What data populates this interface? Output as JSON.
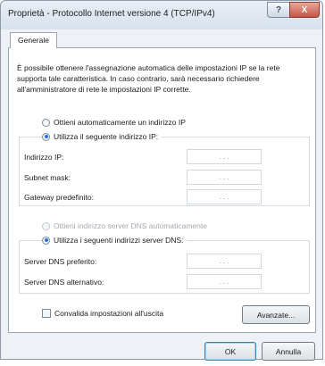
{
  "window": {
    "title": "Proprietà - Protocollo Internet versione 4 (TCP/IPv4)",
    "help_glyph": "?",
    "close_glyph": "X"
  },
  "tabs": [
    {
      "label": "Generale"
    }
  ],
  "description": "È possibile ottenere l'assegnazione automatica delle impostazioni IP se la rete supporta tale caratteristica. In caso contrario, sarà necessario richiedere all'amministratore di rete le impostazioni IP corrette.",
  "ip_section": {
    "auto_option": {
      "label": "Ottieni automaticamente un indirizzo IP",
      "selected": false
    },
    "manual_option": {
      "label": "Utilizza il seguente indirizzo IP:",
      "selected": true
    },
    "fields": [
      {
        "label": "Indirizzo IP:",
        "value": ". . ."
      },
      {
        "label": "Subnet mask:",
        "value": ". . ."
      },
      {
        "label": "Gateway predefinito:",
        "value": ". . ."
      }
    ]
  },
  "dns_section": {
    "auto_option": {
      "label": "Ottieni indirizzo server DNS automaticamente",
      "selected": false,
      "disabled": true
    },
    "manual_option": {
      "label": "Utilizza i seguenti indirizzi server DNS:",
      "selected": true
    },
    "fields": [
      {
        "label": "Server DNS preferito:",
        "value": ". . ."
      },
      {
        "label": "Server DNS alternativo:",
        "value": ". . ."
      }
    ]
  },
  "validate_checkbox": {
    "label": "Convalida impostazioni all'uscita",
    "checked": false
  },
  "buttons": {
    "advanced": "Avanzate...",
    "ok": "OK",
    "cancel": "Annulla"
  },
  "colors": {
    "accent_radio": "#2a6fd6",
    "close_button": "#c75446",
    "window_bg": "#eef2f7"
  }
}
